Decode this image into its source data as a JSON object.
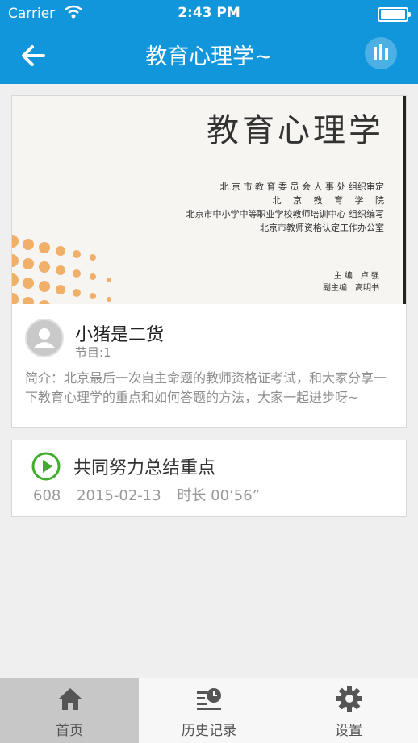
{
  "status_bar": {
    "carrier": "Carrier",
    "time": "2:43 PM"
  },
  "nav": {
    "title": "教育心理学~",
    "back_icon": "back-arrow-icon",
    "stats_icon": "bar-chart-icon"
  },
  "album": {
    "cover": {
      "title": "教育心理学",
      "lines": [
        "北 京 市 教 育 委 员 会 人 事 处 组织审定",
        "北　 京 　教 　育 　学 　院",
        "北京市中小学中等职业学校教师培训中心 组织编写",
        "北京市教师资格认定工作办公室"
      ],
      "editor_line": "主 编　卢 强",
      "deputy_line": "副主编　高明书"
    },
    "author": "小猪是二货",
    "episodes": "节目:1",
    "intro": "简介：北京最后一次自主命题的教师资格证考试，和大家分享一下教育心理学的重点和如何答题的方法，大家一起进步呀~"
  },
  "episode": {
    "title": "共同努力总结重点",
    "plays": "608",
    "date": "2015-02-13",
    "duration": "时长 00’56”"
  },
  "tabs": [
    {
      "label": "首页",
      "icon": "home-icon",
      "active": true
    },
    {
      "label": "历史记录",
      "icon": "history-icon",
      "active": false
    },
    {
      "label": "设置",
      "icon": "gear-icon",
      "active": false
    }
  ],
  "colors": {
    "accent": "#1296db",
    "play_green": "#3fae2a"
  }
}
